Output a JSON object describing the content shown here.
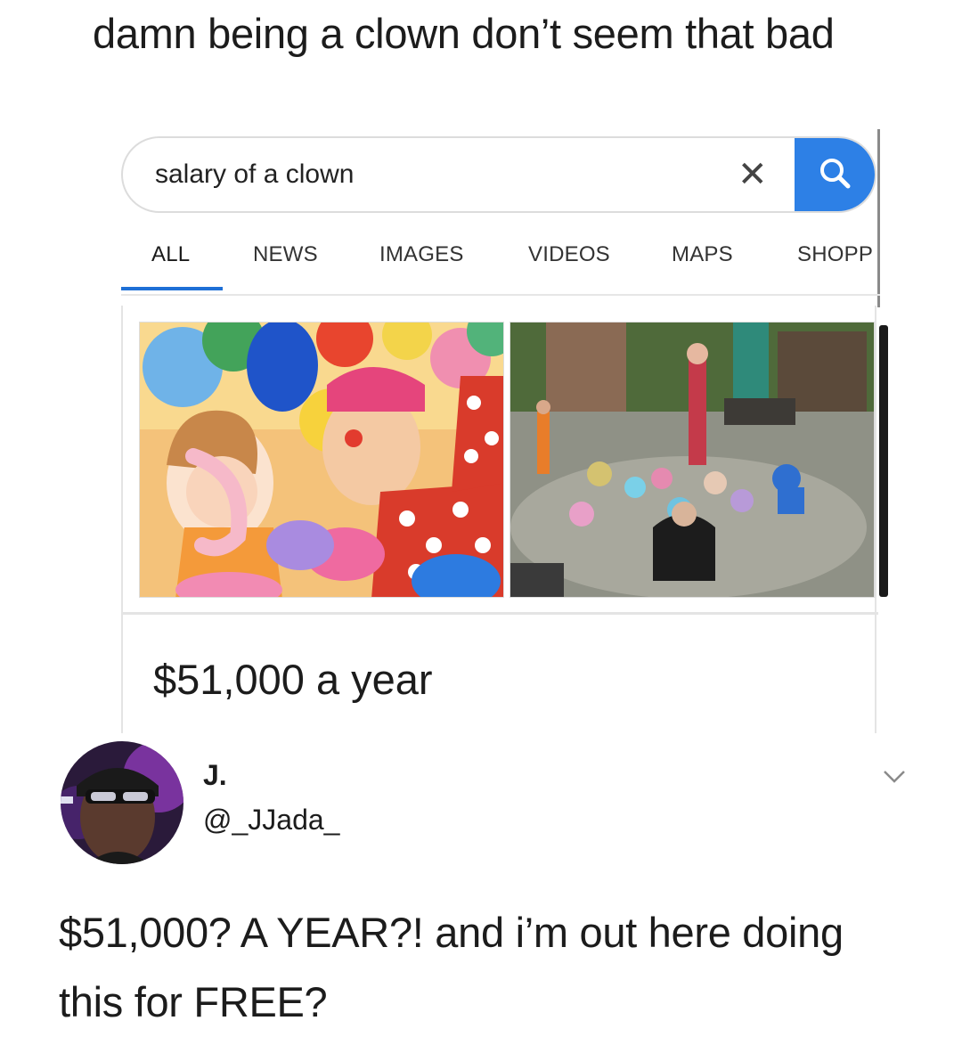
{
  "post": {
    "caption": "damn being a clown don’t seem that bad"
  },
  "search": {
    "query": "salary of a clown",
    "clear_icon": "close-icon",
    "search_icon": "search-icon",
    "accent_color": "#2d80e6"
  },
  "tabs": [
    {
      "label": "ALL",
      "active": true
    },
    {
      "label": "NEWS",
      "active": false
    },
    {
      "label": "IMAGES",
      "active": false
    },
    {
      "label": "VIDEOS",
      "active": false
    },
    {
      "label": "MAPS",
      "active": false
    },
    {
      "label": "SHOPP",
      "active": false
    }
  ],
  "result": {
    "answer": "$51,000 a year"
  },
  "reply": {
    "name": "J.",
    "handle": "@_JJada_",
    "text": "$51,000? A YEAR?! and i’m out here doing this for FREE?",
    "menu_icon": "chevron-down-icon"
  }
}
